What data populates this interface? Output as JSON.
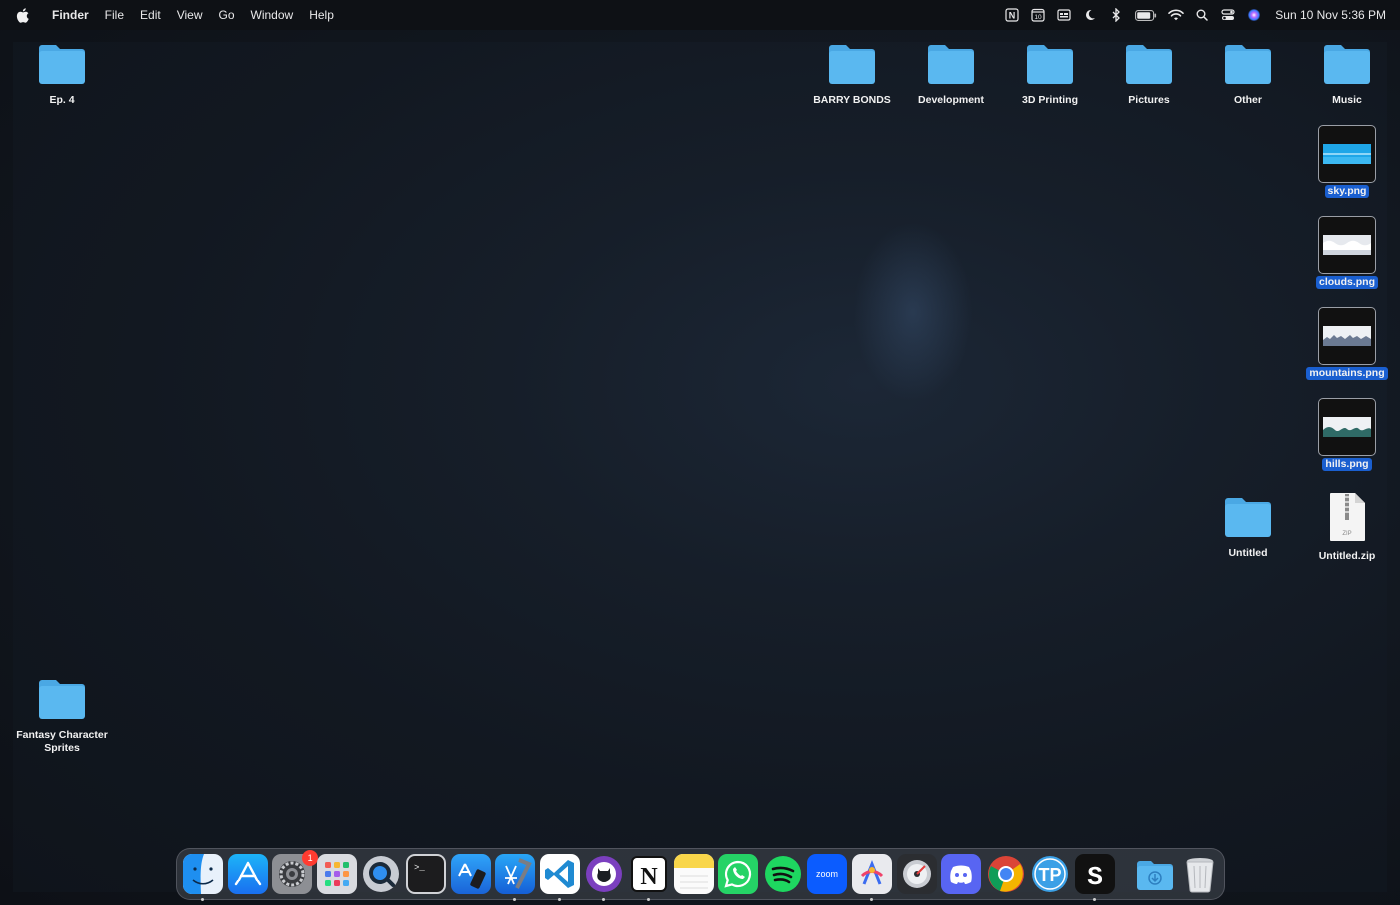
{
  "menubar": {
    "app_name": "Finder",
    "menus": [
      "File",
      "Edit",
      "View",
      "Go",
      "Window",
      "Help"
    ],
    "status_icons": [
      "notion-icon",
      "calendar-10-icon",
      "screen-recorder-icon",
      "moon-icon",
      "bluetooth-icon",
      "battery-icon",
      "wifi-icon",
      "search-icon",
      "control-center-icon",
      "siri-icon"
    ],
    "calendar_icon_text": "10",
    "notion_icon_text": "N",
    "clock": "Sun 10 Nov  5:36 PM"
  },
  "desktop": {
    "folders": [
      {
        "label": "Ep. 4"
      },
      {
        "label": "BARRY BONDS"
      },
      {
        "label": "Development"
      },
      {
        "label": "3D Printing"
      },
      {
        "label": "Pictures"
      },
      {
        "label": "Other"
      },
      {
        "label": "Music"
      },
      {
        "label": "Untitled"
      },
      {
        "label": "Fantasy Character Sprites"
      }
    ],
    "files": [
      {
        "label": "sky.png",
        "selected": true
      },
      {
        "label": "clouds.png",
        "selected": true
      },
      {
        "label": "mountains.png",
        "selected": true
      },
      {
        "label": "hills.png",
        "selected": true
      },
      {
        "label": "Untitled.zip",
        "selected": false,
        "type_text": "ZIP"
      }
    ]
  },
  "dock": {
    "apps": [
      {
        "name": "finder-icon",
        "running": true
      },
      {
        "name": "app-store-icon",
        "running": false
      },
      {
        "name": "system-settings-icon",
        "running": false,
        "badge": "1"
      },
      {
        "name": "launchpad-icon",
        "running": false
      },
      {
        "name": "quicktime-icon",
        "running": false
      },
      {
        "name": "terminal-icon",
        "running": false
      },
      {
        "name": "simulator-icon",
        "running": false
      },
      {
        "name": "xcode-icon",
        "running": true
      },
      {
        "name": "vscode-icon",
        "running": true
      },
      {
        "name": "github-desktop-icon",
        "running": true
      },
      {
        "name": "notion-icon",
        "running": true
      },
      {
        "name": "notes-icon",
        "running": false
      },
      {
        "name": "whatsapp-icon",
        "running": false
      },
      {
        "name": "spotify-icon",
        "running": false
      },
      {
        "name": "zoom-icon",
        "running": false
      },
      {
        "name": "craft-icon",
        "running": true
      },
      {
        "name": "disk-utility-icon",
        "running": false
      },
      {
        "name": "discord-icon",
        "running": false
      },
      {
        "name": "chrome-icon",
        "running": false
      },
      {
        "name": "texturepacker-icon",
        "running": false
      },
      {
        "name": "aseprite-icon",
        "running": true
      },
      {
        "name": "downloads-stack-icon",
        "running": false
      },
      {
        "name": "trash-icon",
        "running": false
      }
    ],
    "zoom_text": "zoom",
    "terminal_text": ">_",
    "texturepacker_text": "TP",
    "aseprite_text": "S",
    "notion_text": "N"
  },
  "colors": {
    "folder": "#5ab8f0",
    "selection": "#1a5fd0"
  }
}
